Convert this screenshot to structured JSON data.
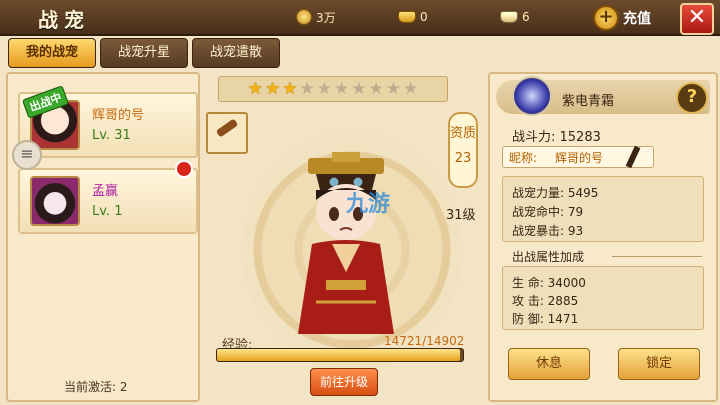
{
  "header": {
    "title": "战宠",
    "resources": [
      {
        "icon": "coin-icon",
        "value": "3万"
      },
      {
        "icon": "gold-ingot-icon",
        "value": "0"
      },
      {
        "icon": "silver-ingot-icon",
        "value": "6"
      }
    ],
    "recharge_label": "充值",
    "close_label": "✕"
  },
  "tabs": [
    {
      "label": "我的战宠",
      "active": true
    },
    {
      "label": "战宠升星",
      "active": false
    },
    {
      "label": "战宠遣散",
      "active": false
    }
  ],
  "pet_list": [
    {
      "name": "辉哥的号",
      "level": "Lv. 31",
      "badge": "出战中",
      "name_color": "#c46a10"
    },
    {
      "name": "孟赢",
      "level": "Lv. 1",
      "badge": "",
      "name_color": "#b020a0"
    }
  ],
  "active_count_label": "当前激活: 2",
  "pet_detail": {
    "stars_total": 10,
    "stars_lit": 3,
    "aptitude_label": "资质",
    "aptitude_value": "23",
    "level": "31级",
    "watermark": "九游",
    "exp_label": "经验:",
    "exp_value": "14721/14902",
    "exp_current": 14721,
    "exp_max": 14902,
    "upgrade_label": "前往升级"
  },
  "info": {
    "skill_name": "紫电青霜",
    "help_label": "?",
    "power": "战斗力: 15283",
    "nickname_label": "昵称:",
    "nickname_value": "辉哥的号",
    "attributes": [
      "战宠力量: 5495",
      "战宠命中: 79",
      "战宠暴击: 93"
    ],
    "bonus_title": "出战属性加成",
    "bonus": [
      "生 命: 34000",
      "攻 击: 2885",
      "防 御: 1471"
    ],
    "rest_label": "休息",
    "lock_label": "锁定"
  },
  "colors": {
    "accent": "#e59a1e",
    "panel": "#f7e9c9",
    "header": "#4a301a"
  }
}
